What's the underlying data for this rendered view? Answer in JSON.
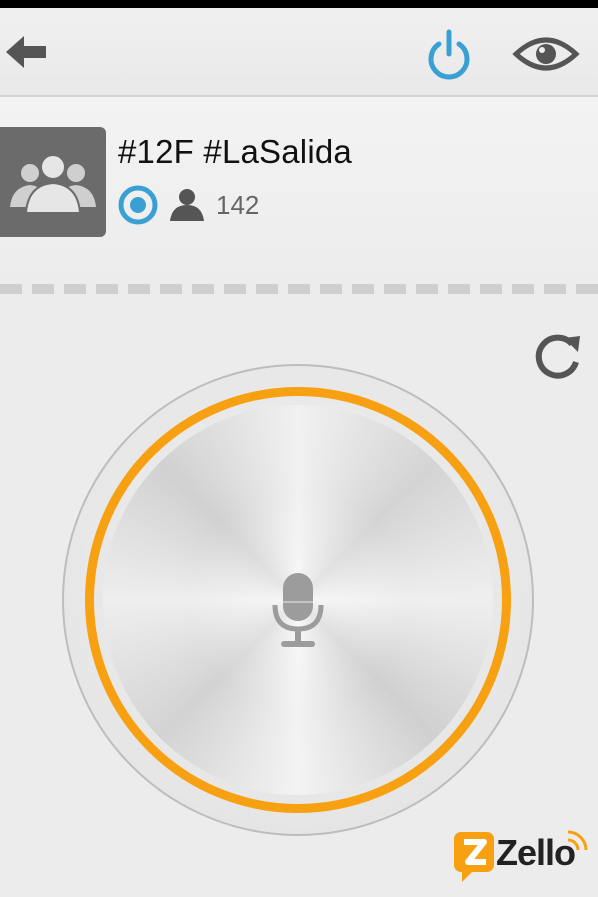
{
  "topbar": {
    "back_icon": "arrow-left-icon",
    "power_icon": "power-icon",
    "eye_icon": "eye-icon",
    "power_color": "#3aa0d4"
  },
  "channel": {
    "title": "#12F #LaSalida",
    "avatar_icon": "group-icon",
    "status_icon": "online-status-icon",
    "user_icon": "user-icon",
    "user_count": "142"
  },
  "talk": {
    "refresh_icon": "refresh-icon",
    "mic_icon": "microphone-icon",
    "ring_color": "#f7a012"
  },
  "branding": {
    "logo_text": "Zello",
    "brand_color": "#f7a012"
  }
}
